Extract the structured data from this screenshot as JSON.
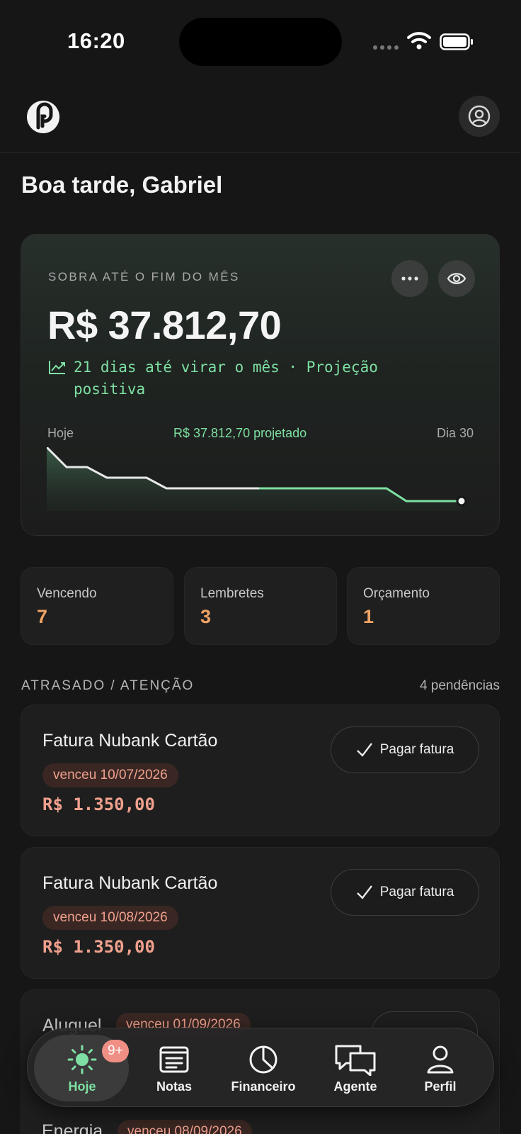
{
  "status": {
    "time": "16:20"
  },
  "greeting": "Boa tarde, Gabriel",
  "projection": {
    "label": "SOBRA ATÉ O FIM DO MÊS",
    "amount": "R$ 37.812,70",
    "trend_text": "21 dias até virar o mês · Projeção positiva",
    "chart_start_label": "Hoje",
    "chart_projection_label": "R$ 37.812,70 projetado",
    "chart_end_label": "Dia 30"
  },
  "stats": [
    {
      "label": "Vencendo",
      "value": "7"
    },
    {
      "label": "Lembretes",
      "value": "3"
    },
    {
      "label": "Orçamento",
      "value": "1"
    }
  ],
  "section": {
    "title": "ATRASADO / ATENÇÃO",
    "count": "4 pendências"
  },
  "bills": [
    {
      "title": "Fatura Nubank Cartão",
      "badge": "venceu 10/07/2026",
      "amount": "R$ 1.350,00",
      "action": "Pagar fatura"
    },
    {
      "title": "Fatura Nubank Cartão",
      "badge": "venceu 10/08/2026",
      "amount": "R$ 1.350,00",
      "action": "Pagar fatura"
    },
    {
      "title": "Aluguel",
      "badge": "venceu 01/09/2026"
    },
    {
      "title": "Energia",
      "badge": "venceu 08/09/2026"
    }
  ],
  "nav": {
    "badge": "9+",
    "items": [
      {
        "label": "Hoje",
        "icon": "sun-icon"
      },
      {
        "label": "Notas",
        "icon": "notes-icon"
      },
      {
        "label": "Financeiro",
        "icon": "pie-chart-icon"
      },
      {
        "label": "Agente",
        "icon": "chat-icon"
      },
      {
        "label": "Perfil",
        "icon": "user-icon"
      }
    ]
  },
  "colors": {
    "accent_green": "#7ee0a3",
    "warning_orange": "#f0a465",
    "danger_red": "#f0a18e"
  }
}
